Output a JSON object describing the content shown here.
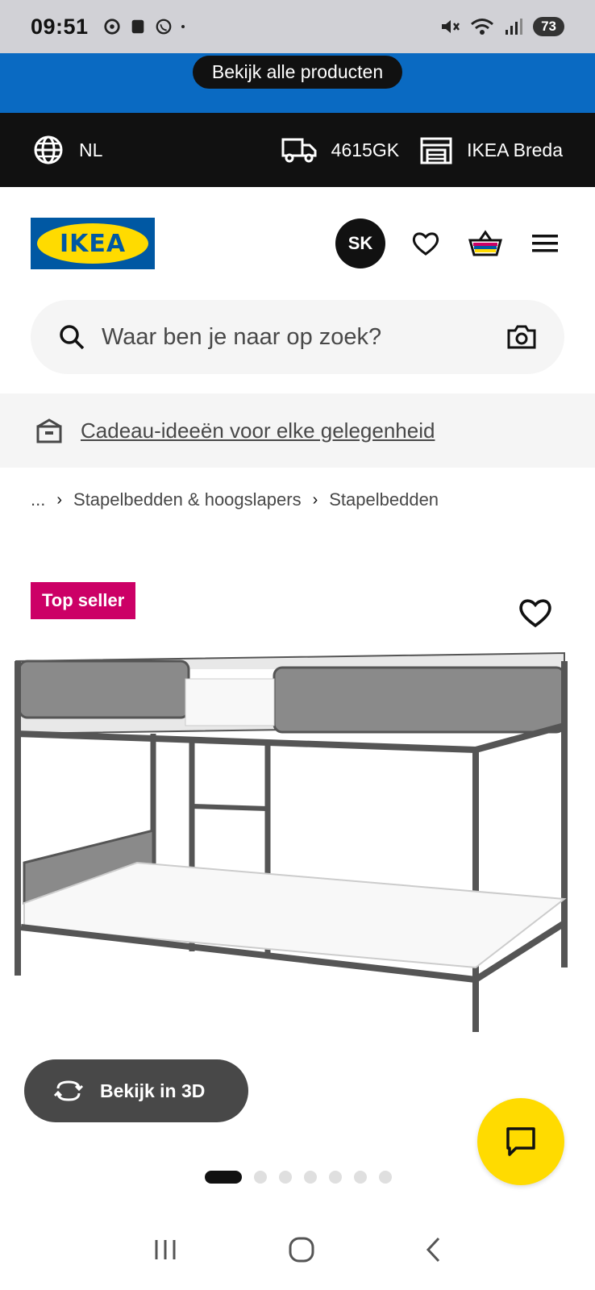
{
  "status_bar": {
    "time": "09:51",
    "battery": "73"
  },
  "promo": {
    "label": "Bekijk alle producten"
  },
  "locale": {
    "language": "NL",
    "postcode": "4615GK",
    "store": "IKEA Breda"
  },
  "header": {
    "logo_text": "IKEA",
    "avatar_initials": "SK"
  },
  "search": {
    "placeholder": "Waar ben je naar op zoek?"
  },
  "gift": {
    "label": "Cadeau-ideeën voor elke gelegenheid"
  },
  "breadcrumb": {
    "items": [
      "...",
      "Stapelbedden & hoogslapers",
      "Stapelbedden"
    ]
  },
  "product": {
    "badge": "Top seller",
    "view3d_label": "Bekijk in 3D",
    "carousel": {
      "total": 7,
      "active": 1
    }
  },
  "colors": {
    "promo_blue": "#0a6ac2",
    "ikea_yellow": "#ffdb00",
    "ikea_blue": "#0058a3",
    "badge_pink": "#cc0066"
  }
}
